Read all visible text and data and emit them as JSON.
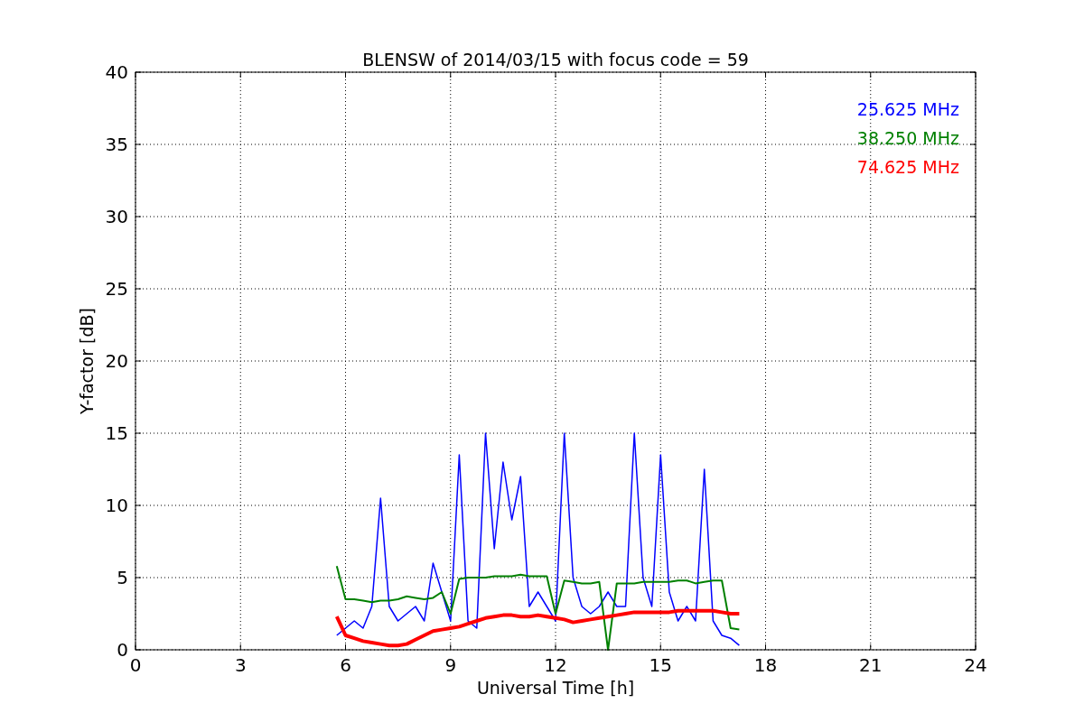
{
  "chart_data": {
    "type": "line",
    "title": "BLENSW of 2014/03/15 with focus code = 59",
    "xlabel": "Universal Time [h]",
    "ylabel": "Y-factor [dB]",
    "xlim": [
      0,
      24
    ],
    "ylim": [
      0,
      40
    ],
    "xticks": [
      0,
      3,
      6,
      9,
      12,
      15,
      18,
      21,
      24
    ],
    "yticks": [
      0,
      5,
      10,
      15,
      20,
      25,
      30,
      35,
      40
    ],
    "grid": true,
    "x": [
      5.75,
      6,
      6.25,
      6.5,
      6.75,
      7,
      7.25,
      7.5,
      7.75,
      8,
      8.25,
      8.5,
      8.75,
      9,
      9.25,
      9.5,
      9.75,
      10,
      10.25,
      10.5,
      10.75,
      11,
      11.25,
      11.5,
      11.75,
      12,
      12.25,
      12.5,
      12.75,
      13,
      13.25,
      13.5,
      13.75,
      14,
      14.25,
      14.5,
      14.75,
      15,
      15.25,
      15.5,
      15.75,
      16,
      16.25,
      16.5,
      16.75,
      17,
      17.25
    ],
    "series": [
      {
        "name": "25.625 MHz",
        "color": "#0000ff",
        "values": [
          1,
          1.5,
          2,
          1.5,
          3,
          10.5,
          3,
          2,
          2.5,
          3,
          2,
          6,
          4,
          2,
          13.5,
          2,
          1.5,
          15,
          7,
          13,
          9,
          12,
          3,
          4,
          3,
          2,
          15,
          5,
          3,
          2.5,
          3,
          4,
          3,
          3,
          15,
          5,
          3,
          13.5,
          4,
          2,
          3,
          2,
          12.5,
          2,
          1,
          0.8,
          0.3
        ]
      },
      {
        "name": "38.250 MHz",
        "color": "#008000",
        "values": [
          5.8,
          3.5,
          3.5,
          3.4,
          3.3,
          3.4,
          3.4,
          3.5,
          3.7,
          3.6,
          3.5,
          3.6,
          4,
          2.5,
          4.9,
          5,
          5,
          5,
          5.1,
          5.1,
          5.1,
          5.2,
          5.1,
          5.1,
          5.1,
          2.5,
          4.8,
          4.7,
          4.6,
          4.6,
          4.7,
          0,
          4.6,
          4.6,
          4.6,
          4.7,
          4.7,
          4.7,
          4.7,
          4.8,
          4.8,
          4.6,
          4.7,
          4.8,
          4.8,
          1.5,
          1.4
        ]
      },
      {
        "name": "74.625 MHz",
        "color": "#ff0000",
        "values": [
          2.3,
          1,
          0.8,
          0.6,
          0.5,
          0.4,
          0.3,
          0.3,
          0.4,
          0.7,
          1,
          1.3,
          1.4,
          1.5,
          1.6,
          1.8,
          2,
          2.2,
          2.3,
          2.4,
          2.4,
          2.3,
          2.3,
          2.4,
          2.3,
          2.2,
          2.1,
          1.9,
          2,
          2.1,
          2.2,
          2.3,
          2.4,
          2.5,
          2.6,
          2.6,
          2.6,
          2.6,
          2.6,
          2.7,
          2.7,
          2.7,
          2.7,
          2.7,
          2.6,
          2.5,
          2.5
        ]
      }
    ]
  }
}
